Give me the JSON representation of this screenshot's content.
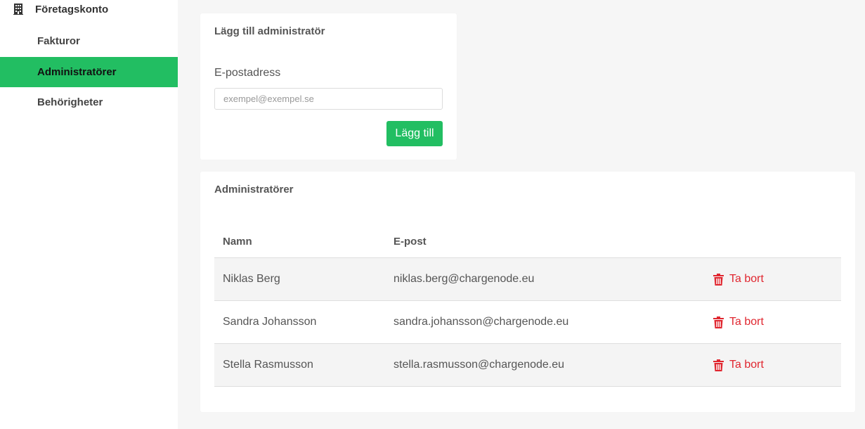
{
  "sidebar": {
    "header": {
      "label": "Företagskonto",
      "icon": "building-icon"
    },
    "items": [
      {
        "label": "Fakturor",
        "active": false
      },
      {
        "label": "Administratörer",
        "active": true
      },
      {
        "label": "Behörigheter",
        "active": false
      }
    ]
  },
  "add_admin": {
    "title": "Lägg till administratör",
    "email_label": "E-postadress",
    "email_placeholder": "exempel@exempel.se",
    "email_value": "",
    "submit_label": "Lägg till"
  },
  "admins": {
    "title": "Administratörer",
    "columns": {
      "name": "Namn",
      "email": "E-post"
    },
    "rows": [
      {
        "name": "Niklas Berg",
        "email": "niklas.berg@chargenode.eu",
        "action": "Ta bort"
      },
      {
        "name": "Sandra Johansson",
        "email": "sandra.johansson@chargenode.eu",
        "action": "Ta bort"
      },
      {
        "name": "Stella Rasmusson",
        "email": "stella.rasmusson@chargenode.eu",
        "action": "Ta bort"
      }
    ],
    "action_icon": "trash-icon"
  },
  "colors": {
    "accent": "#22be62",
    "danger": "#e0262f",
    "background": "#f6f6f6"
  }
}
